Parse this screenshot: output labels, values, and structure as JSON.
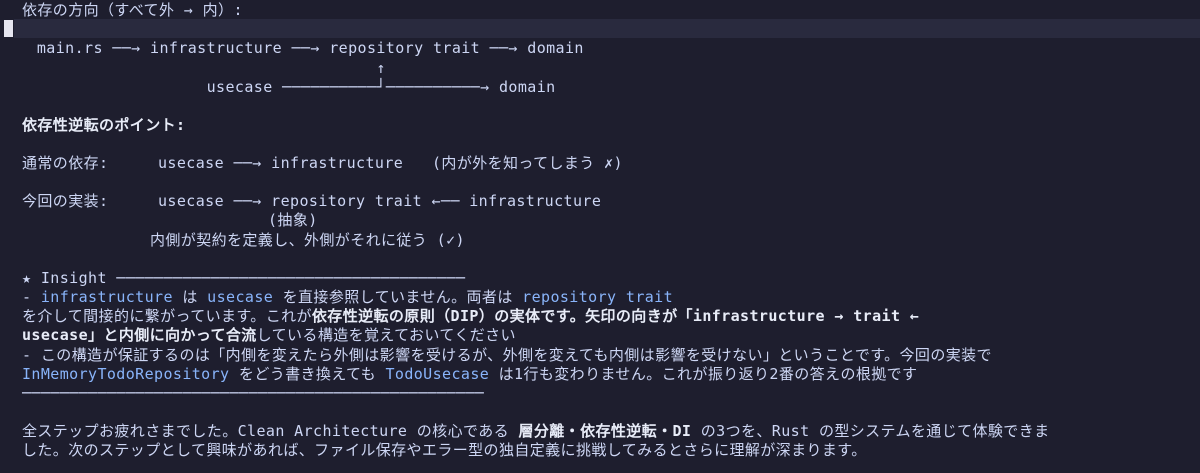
{
  "theme": {
    "bg": "#1e1e2e",
    "fg": "#cdd6f4",
    "code": "#89b4fa",
    "bold": "#e8ecf8"
  },
  "lines": {
    "heading_dep_dir": "依存の方向（すべて外 → 内）:",
    "diagram_1": "  main.rs ──→ infrastructure ──→ repository trait ──→ domain",
    "diagram_2": "                                      ↑",
    "diagram_3": "                    usecase ──────────┘──────────→ domain",
    "heading_dip": "依存性逆転のポイント:",
    "normal_label": "通常の依存:",
    "normal_flow": "usecase ──→ infrastructure",
    "normal_note": "(内が外を知ってしまう ✗)",
    "current_label": "今回の実装:",
    "current_flow": "usecase ──→ repository trait ←── infrastructure",
    "abstract_label": "(抽象)",
    "inner_note": "内側が契約を定義し、外側がそれに従う (✓)",
    "insight_header": "★ Insight ─────────────────────────────────────",
    "i1_a": "- ",
    "i1_code1": "infrastructure",
    "i1_b": " は ",
    "i1_code2": "usecase",
    "i1_c": " を直接参照していません。両者は ",
    "i1_code3": "repository trait",
    "i2_a": "を介して間接的に繋がっています。これが",
    "i2_bold": "依存性逆転の原則（DIP）の実体です。矢印の向きが「infrastructure → trait ←",
    "i3_bold": "usecase」と内側に向かって合流",
    "i3_rest": "している構造を覚えておいてください",
    "i4": "- この構造が保証するのは「内側を変えたら外側は影響を受けるが、外側を変えても内側は影響を受けない」ということです。今回の実装で",
    "i5_code1": "InMemoryTodoRepository",
    "i5_a": " をどう書き換えても ",
    "i5_code2": "TodoUsecase",
    "i5_b": " は1行も変わりません。これが振り返り2番の答えの根拠です",
    "insight_footer": "─────────────────────────────────────────────────",
    "f1_a": "全ステップお疲れさまでした。Clean Architecture の核心である ",
    "f1_bold": "層分離・依存性逆転・DI",
    "f1_b": " の3つを、Rust の型システムを通じて体験できま",
    "f2": "した。次のステップとして興味があれば、ファイル保存やエラー型の独自定義に挑戦してみるとさらに理解が深まります。"
  }
}
